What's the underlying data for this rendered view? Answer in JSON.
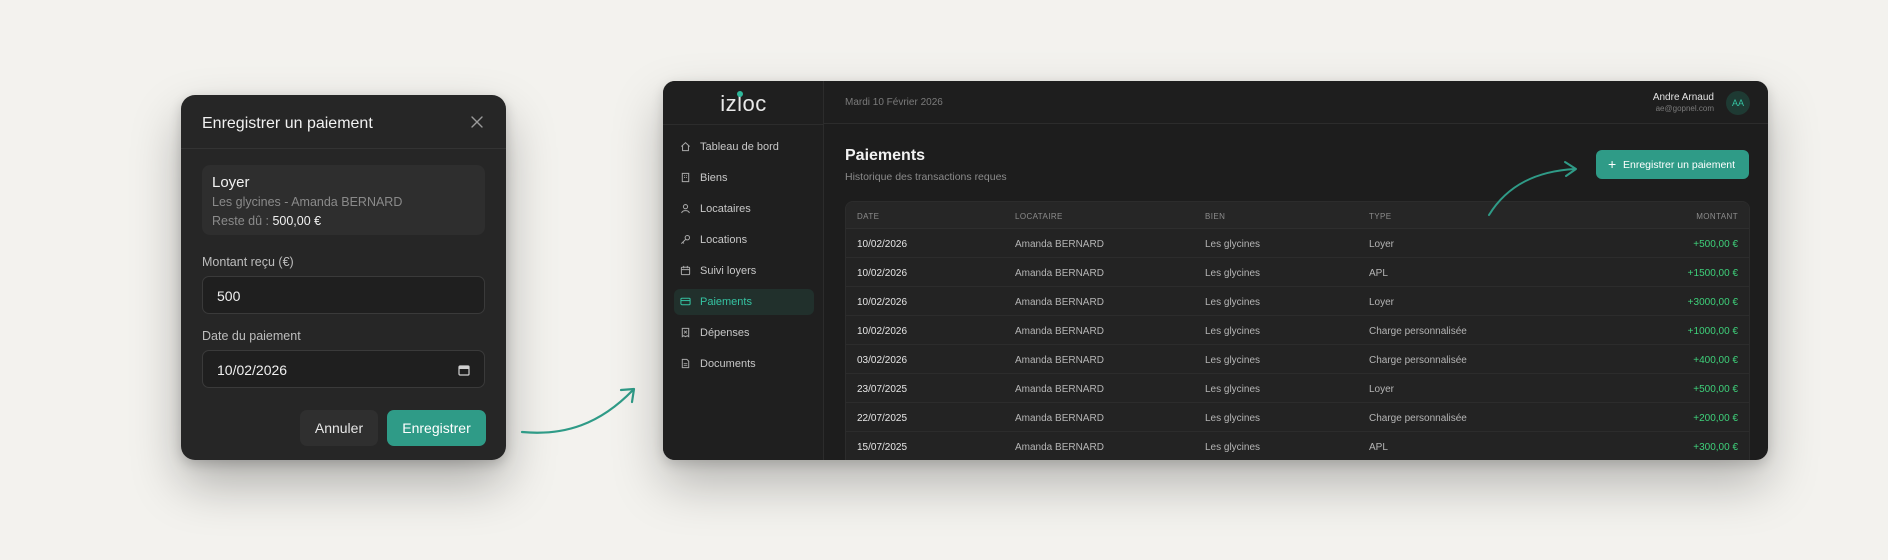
{
  "modal": {
    "title": "Enregistrer un paiement",
    "summary": {
      "type": "Loyer",
      "subtitle": "Les glycines - Amanda BERNARD",
      "due_label": "Reste dû : ",
      "due_value": "500,00 €"
    },
    "amount_label": "Montant reçu (€)",
    "amount_value": "500",
    "date_label": "Date du paiement",
    "date_value": "10/02/2026",
    "cancel_label": "Annuler",
    "save_label": "Enregistrer"
  },
  "app": {
    "logo": "izloc",
    "date": "Mardi 10 Février 2026",
    "user": {
      "name": "Andre Arnaud",
      "email": "ae@gopnel.com",
      "initials": "AA"
    },
    "nav": [
      {
        "label": "Tableau de bord",
        "icon": "home-icon",
        "active": false
      },
      {
        "label": "Biens",
        "icon": "building-icon",
        "active": false
      },
      {
        "label": "Locataires",
        "icon": "user-icon",
        "active": false
      },
      {
        "label": "Locations",
        "icon": "key-icon",
        "active": false
      },
      {
        "label": "Suivi loyers",
        "icon": "calendar-icon",
        "active": false
      },
      {
        "label": "Paiements",
        "icon": "card-icon",
        "active": true
      },
      {
        "label": "Dépenses",
        "icon": "receipt-icon",
        "active": false
      },
      {
        "label": "Documents",
        "icon": "document-icon",
        "active": false
      }
    ],
    "page_title": "Paiements",
    "page_subtitle": "Historique des transactions reques",
    "add_button": "Enregistrer un paiement",
    "table": {
      "columns": [
        "DATE",
        "LOCATAIRE",
        "BIEN",
        "TYPE",
        "MONTANT"
      ],
      "rows": [
        [
          "10/02/2026",
          "Amanda BERNARD",
          "Les glycines",
          "Loyer",
          "+500,00 €"
        ],
        [
          "10/02/2026",
          "Amanda BERNARD",
          "Les glycines",
          "APL",
          "+1500,00 €"
        ],
        [
          "10/02/2026",
          "Amanda BERNARD",
          "Les glycines",
          "Loyer",
          "+3000,00 €"
        ],
        [
          "10/02/2026",
          "Amanda BERNARD",
          "Les glycines",
          "Charge personnalisée",
          "+1000,00 €"
        ],
        [
          "03/02/2026",
          "Amanda BERNARD",
          "Les glycines",
          "Charge personnalisée",
          "+400,00 €"
        ],
        [
          "23/07/2025",
          "Amanda BERNARD",
          "Les glycines",
          "Loyer",
          "+500,00 €"
        ],
        [
          "22/07/2025",
          "Amanda BERNARD",
          "Les glycines",
          "Charge personnalisée",
          "+200,00 €"
        ],
        [
          "15/07/2025",
          "Amanda BERNARD",
          "Les glycines",
          "APL",
          "+300,00 €"
        ]
      ]
    }
  },
  "colors": {
    "accent": "#2f9b87",
    "accent_text": "#35c3a2",
    "positive": "#3ed07a"
  }
}
